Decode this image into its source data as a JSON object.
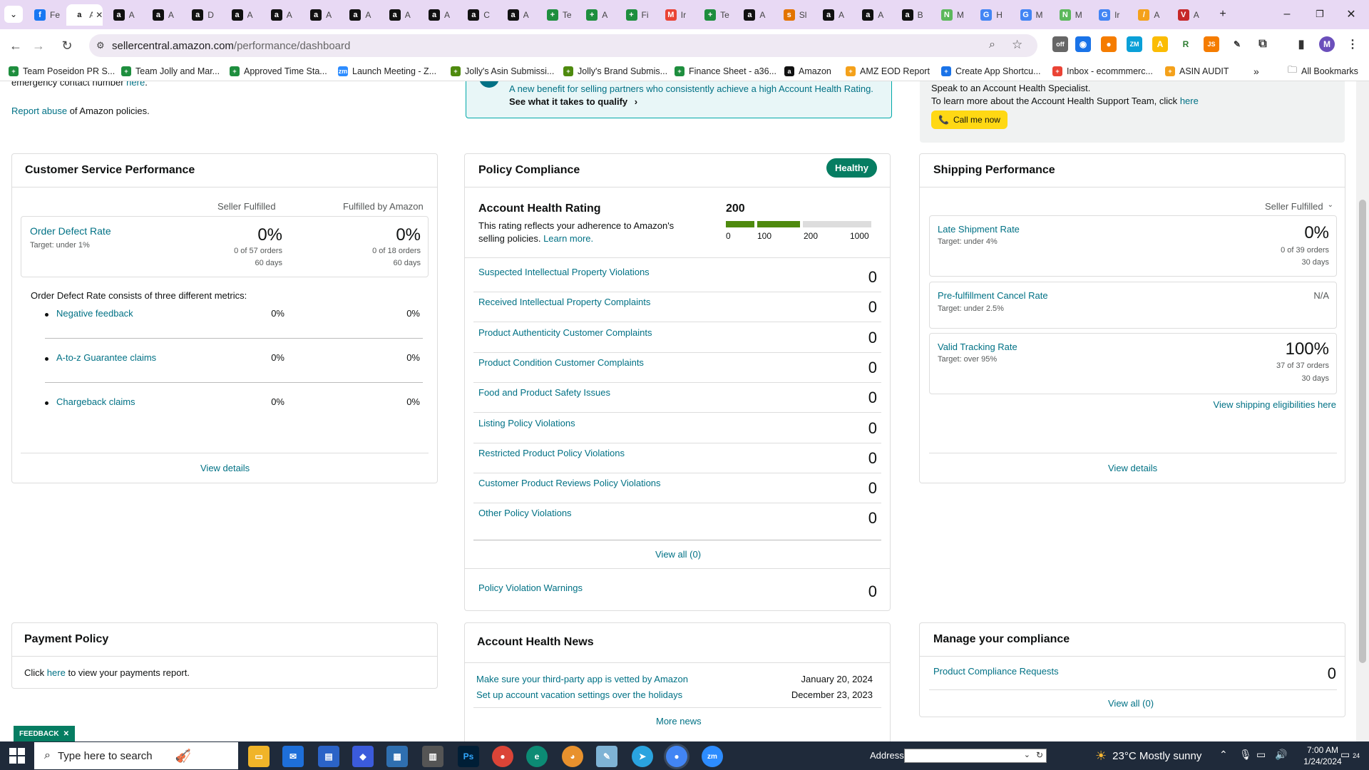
{
  "browser": {
    "tabs": [
      {
        "label": "Fe",
        "fav_bg": "#1877f2",
        "fav_glyph": "f"
      },
      {
        "label": "A",
        "fav_bg": "#ffffff",
        "fav_glyph": "a",
        "active": true
      },
      {
        "label": "A",
        "fav_bg": "#111111",
        "fav_glyph": "a"
      },
      {
        "label": "A",
        "fav_bg": "#111111",
        "fav_glyph": "a"
      },
      {
        "label": "D",
        "fav_bg": "#111111",
        "fav_glyph": "a"
      },
      {
        "label": "A",
        "fav_bg": "#111111",
        "fav_glyph": "a"
      },
      {
        "label": "A",
        "fav_bg": "#111111",
        "fav_glyph": "a"
      },
      {
        "label": "A",
        "fav_bg": "#111111",
        "fav_glyph": "a"
      },
      {
        "label": "A",
        "fav_bg": "#111111",
        "fav_glyph": "a"
      },
      {
        "label": "A",
        "fav_bg": "#111111",
        "fav_glyph": "a"
      },
      {
        "label": "A",
        "fav_bg": "#111111",
        "fav_glyph": "a"
      },
      {
        "label": "C",
        "fav_bg": "#111111",
        "fav_glyph": "a"
      },
      {
        "label": "A",
        "fav_bg": "#111111",
        "fav_glyph": "a"
      },
      {
        "label": "Te",
        "fav_bg": "#1e8e3e",
        "fav_glyph": "+"
      },
      {
        "label": "A",
        "fav_bg": "#1e8e3e",
        "fav_glyph": "+"
      },
      {
        "label": "Fi",
        "fav_bg": "#1e8e3e",
        "fav_glyph": "+"
      },
      {
        "label": "Ir",
        "fav_bg": "#ea4335",
        "fav_glyph": "M"
      },
      {
        "label": "Te",
        "fav_bg": "#1e8e3e",
        "fav_glyph": "+"
      },
      {
        "label": "A",
        "fav_bg": "#111111",
        "fav_glyph": "a"
      },
      {
        "label": "Sl",
        "fav_bg": "#e37400",
        "fav_glyph": "s"
      },
      {
        "label": "A",
        "fav_bg": "#111111",
        "fav_glyph": "a"
      },
      {
        "label": "A",
        "fav_bg": "#111111",
        "fav_glyph": "a"
      },
      {
        "label": "B",
        "fav_bg": "#111111",
        "fav_glyph": "a"
      },
      {
        "label": "M",
        "fav_bg": "#5cb85c",
        "fav_glyph": "N"
      },
      {
        "label": "H",
        "fav_bg": "#4285f4",
        "fav_glyph": "G"
      },
      {
        "label": "M",
        "fav_bg": "#4285f4",
        "fav_glyph": "G"
      },
      {
        "label": "M",
        "fav_bg": "#5cb85c",
        "fav_glyph": "N"
      },
      {
        "label": "Ir",
        "fav_bg": "#4285f4",
        "fav_glyph": "G"
      },
      {
        "label": "A",
        "fav_bg": "#f4a11b",
        "fav_glyph": "/"
      },
      {
        "label": "A",
        "fav_bg": "#c62828",
        "fav_glyph": "V"
      }
    ],
    "url_host": "sellercentral.amazon.com",
    "url_path": "/performance/dashboard",
    "bookmarks": [
      "Team Poseidon PR S...",
      "Team Jolly and Mar...",
      "Approved Time Sta...",
      "Launch Meeting - Z...",
      "Jolly's Asin Submissi...",
      "Jolly's Brand Submis...",
      "Finance Sheet - a36...",
      "Amazon",
      "AMZ EOD Report",
      "Create App Shortcu...",
      "Inbox - ecommmerc...",
      "ASIN AUDIT"
    ],
    "all_bookmarks": "All Bookmarks",
    "profile_initial": "M"
  },
  "top": {
    "contact_text": "emergency contact number",
    "contact_link": "here",
    "report_link": "Report abuse",
    "report_text": "of Amazon policies.",
    "benefit_text": "A new benefit for selling partners who consistently achieve a high Account Health Rating.",
    "benefit_link": "See what it takes to qualify",
    "specialist_line": "Speak to an Account Health Specialist.",
    "support_line": "To learn more about the Account Health Support Team, click",
    "support_link": "here",
    "call_button": "Call me now"
  },
  "customer_service": {
    "title": "Customer Service Performance",
    "col_seller": "Seller Fulfilled",
    "col_fba": "Fulfilled by Amazon",
    "odr_label": "Order Defect Rate",
    "odr_target": "Target: under 1%",
    "odr_seller_value": "0%",
    "odr_seller_orders": "0 of 57 orders",
    "odr_seller_days": "60 days",
    "odr_fba_value": "0%",
    "odr_fba_orders": "0 of 18 orders",
    "odr_fba_days": "60 days",
    "consists_text": "Order Defect Rate consists of three different metrics:",
    "metrics": [
      {
        "label": "Negative feedback",
        "seller": "0%",
        "fba": "0%"
      },
      {
        "label": "A-to-z Guarantee claims",
        "seller": "0%",
        "fba": "0%"
      },
      {
        "label": "Chargeback claims",
        "seller": "0%",
        "fba": "0%"
      }
    ],
    "view_details": "View details"
  },
  "policy": {
    "title": "Policy Compliance",
    "badge": "Healthy",
    "ahr_title": "Account Health Rating",
    "ahr_desc": "This rating reflects your adherence to Amazon's selling policies.",
    "ahr_learn": "Learn more.",
    "ahr_value": "200",
    "ahr_fraction": 0.2,
    "scale": [
      "0",
      "100",
      "200",
      "1000"
    ],
    "violations": [
      {
        "label": "Suspected Intellectual Property Violations",
        "count": "0"
      },
      {
        "label": "Received Intellectual Property Complaints",
        "count": "0"
      },
      {
        "label": "Product Authenticity Customer Complaints",
        "count": "0"
      },
      {
        "label": "Product Condition Customer Complaints",
        "count": "0"
      },
      {
        "label": "Food and Product Safety Issues",
        "count": "0"
      },
      {
        "label": "Listing Policy Violations",
        "count": "0"
      },
      {
        "label": "Restricted Product Policy Violations",
        "count": "0"
      },
      {
        "label": "Customer Product Reviews Policy Violations",
        "count": "0"
      },
      {
        "label": "Other Policy Violations",
        "count": "0"
      }
    ],
    "view_all": "View all (0)",
    "warnings_label": "Policy Violation Warnings",
    "warnings_count": "0"
  },
  "shipping": {
    "title": "Shipping Performance",
    "dropdown": "Seller Fulfilled",
    "late_label": "Late Shipment Rate",
    "late_target": "Target: under 4%",
    "late_value": "0%",
    "late_orders": "0 of 39 orders",
    "late_days": "30 days",
    "cancel_label": "Pre-fulfillment Cancel Rate",
    "cancel_target": "Target: under 2.5%",
    "cancel_value": "N/A",
    "vtr_label": "Valid Tracking Rate",
    "vtr_target": "Target: over 95%",
    "vtr_value": "100%",
    "vtr_orders": "37 of 37 orders",
    "vtr_days": "30 days",
    "eligibilities": "View shipping eligibilities here",
    "view_details": "View details"
  },
  "payment": {
    "title": "Payment Policy",
    "text_before": "Click",
    "link": "here",
    "text_after": "to view your payments report."
  },
  "news": {
    "title": "Account Health News",
    "items": [
      {
        "label": "Make sure your third-party app is vetted by Amazon",
        "date": "January 20, 2024"
      },
      {
        "label": "Set up account vacation settings over the holidays",
        "date": "December 23, 2023"
      }
    ],
    "more": "More news"
  },
  "compliance": {
    "title": "Manage your compliance",
    "requests_label": "Product Compliance Requests",
    "requests_count": "0",
    "view_all": "View all (0)"
  },
  "feedback_tab": "FEEDBACK",
  "taskbar": {
    "search_placeholder": "Type here to search",
    "address_label": "Address",
    "weather": "23°C  Mostly sunny",
    "time": "7:00 AM",
    "date": "1/24/2024",
    "notif_count": "24"
  },
  "colors": {
    "link": "#007185",
    "healthy": "#067d62",
    "call_button": "#ffd814",
    "accent_bar": "#4e8a0e"
  }
}
